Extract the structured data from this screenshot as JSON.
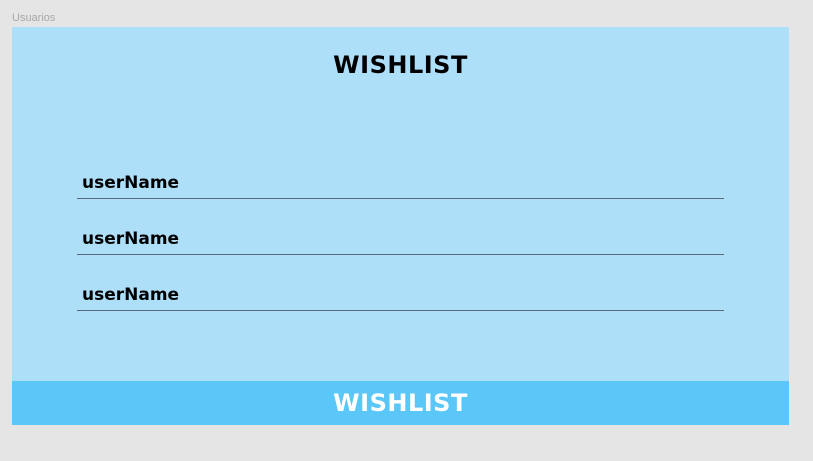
{
  "frame": {
    "label": "Usuarios"
  },
  "header": {
    "title": "WISHLIST"
  },
  "users": [
    {
      "name": "userName"
    },
    {
      "name": "userName"
    },
    {
      "name": "userName"
    }
  ],
  "footer": {
    "button_label": "WISHLIST"
  },
  "colors": {
    "background": "#e5e5e5",
    "panel": "#addff9",
    "footer_bar": "#5bc6f8",
    "divider": "#5a6a78"
  }
}
